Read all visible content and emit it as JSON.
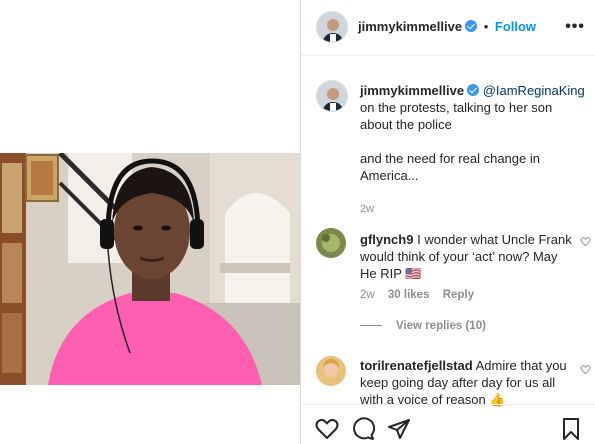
{
  "header": {
    "username": "jimmykimmellive",
    "separator": "•",
    "follow_label": "Follow",
    "more_label": "•••"
  },
  "caption": {
    "username": "jimmykimmellive",
    "mention": "@IamReginaKing",
    "text_1": "on the protests, talking to her son about the police",
    "text_2": "and the need for real change in America...",
    "time": "2w"
  },
  "comments": [
    {
      "username": "gflynch9",
      "text": "I wonder what Uncle Frank would think of your ‘act’ now? May He RIP 🇺🇸",
      "time": "2w",
      "likes": "30 likes",
      "reply_label": "Reply",
      "view_replies": "View replies (10)"
    },
    {
      "username": "torilrenatefjellstad",
      "text": "Admire that you keep going day after day for us all with a voice of reason 👍"
    }
  ],
  "icons": {
    "like": "heart-icon",
    "comment": "comment-icon",
    "share": "send-icon",
    "save": "bookmark-icon"
  },
  "colors": {
    "link_blue": "#0095f6",
    "mention_blue": "#00376b",
    "muted_text": "#8e8e8e"
  }
}
